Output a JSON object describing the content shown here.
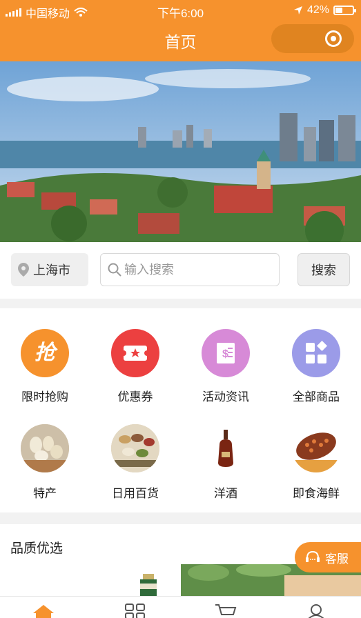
{
  "status_bar": {
    "carrier": "中国移动",
    "time": "下午6:00",
    "battery": "42%",
    "battery_level": 0.42
  },
  "header": {
    "title": "首页"
  },
  "search": {
    "city": "上海市",
    "placeholder": "输入搜索",
    "button": "搜索"
  },
  "categories": [
    {
      "label": "限时抢购",
      "icon": "flash-sale-icon",
      "glyph": "抢",
      "color": "#f6922d"
    },
    {
      "label": "优惠券",
      "icon": "coupon-icon",
      "color": "#ec4040"
    },
    {
      "label": "活动资讯",
      "icon": "activity-news-icon",
      "color": "#d78ad7"
    },
    {
      "label": "全部商品",
      "icon": "all-products-icon",
      "color": "#9b9be8"
    },
    {
      "label": "特产",
      "icon": "specialty-image"
    },
    {
      "label": "日用百货",
      "icon": "daily-goods-image"
    },
    {
      "label": "洋酒",
      "icon": "liquor-image"
    },
    {
      "label": "即食海鲜",
      "icon": "seafood-image"
    }
  ],
  "quality_section": {
    "title": "品质优选"
  },
  "customer_service": {
    "label": "客服"
  },
  "tabbar": {
    "items": [
      {
        "icon": "home-icon"
      },
      {
        "icon": "category-icon"
      },
      {
        "icon": "cart-icon"
      },
      {
        "icon": "profile-icon"
      }
    ]
  },
  "colors": {
    "brand": "#f6922d",
    "capsule": "#e08420"
  }
}
